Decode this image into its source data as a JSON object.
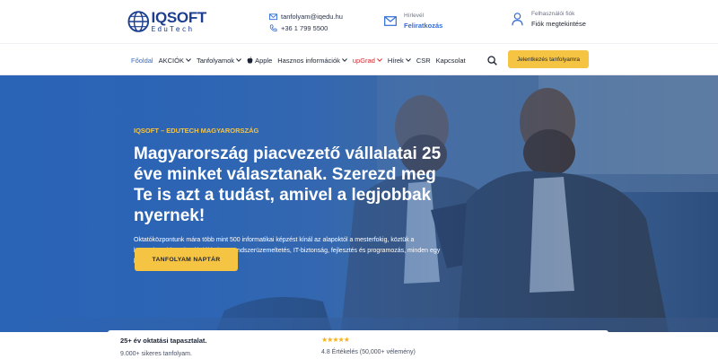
{
  "brand": {
    "name": "IQSOFT",
    "tagline": "EduTech"
  },
  "contact": {
    "email": "tanfolyam@iqedu.hu",
    "phone": "+36 1 799 5500"
  },
  "newsletter": {
    "label": "Hírlevél",
    "link": "Feliratkozás"
  },
  "account": {
    "label": "Felhasználói fiók",
    "link": "Fiók megtekintése"
  },
  "nav": {
    "items": [
      {
        "label": "Főoldal",
        "active": true
      },
      {
        "label": "AKCIÓK",
        "caret": true
      },
      {
        "label": "Tanfolyamok",
        "caret": true
      },
      {
        "label": "Apple",
        "icon": "apple-icon"
      },
      {
        "label": "Hasznos információk",
        "caret": true
      },
      {
        "label": "upGrad",
        "caret": true,
        "highlight": "red"
      },
      {
        "label": "Hírek",
        "caret": true
      },
      {
        "label": "CSR"
      },
      {
        "label": "Kapcsolat"
      }
    ],
    "cta": "Jelentkezés tanfolyamra"
  },
  "hero": {
    "eyebrow": "IQSOFT – EDUTECH MAGYARORSZÁG",
    "headline": "Magyarország piacvezető vállalatai 25 éve minket választanak. Szerezd meg Te is azt a tudást, amivel a legjobbak nyernek!",
    "lead": "Oktatóközpontunk mára több mint 500 informatikai képzést kínál az alapoktól a mesterfokig, köztük a legmodernebb technológiákkal. AI, rendszerüzemeltetés, IT-biztonság, fejlesztés és programozás, minden egy helyen, hiteles szakértőktől!",
    "button": "TANFOLYAM NAPTÁR"
  },
  "stats": {
    "experience": "25+ év oktatási tapasztalat.",
    "courses": "9.000+ sikeres tanfolyam.",
    "stars": "★★★★★",
    "rating": "4.8 Értékelés (50,000+ vélemény)"
  },
  "colors": {
    "accent": "#f6c443",
    "brand_blue": "#1d3f8f",
    "link_blue": "#2f6cd6",
    "highlight_red": "#d8262c",
    "hero_blue": "#2a64b7"
  }
}
